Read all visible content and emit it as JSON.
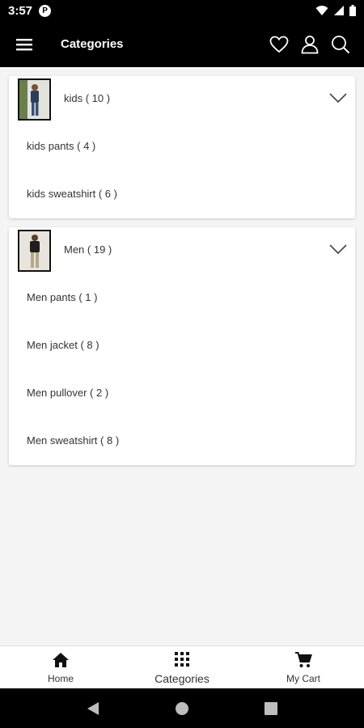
{
  "status_bar": {
    "time": "3:57",
    "app_icon_letter": "P",
    "icons": [
      "wifi-icon",
      "signal-icon",
      "battery-icon"
    ]
  },
  "app_bar": {
    "title": "Categories",
    "icons": [
      "menu-icon",
      "heart-icon",
      "user-icon",
      "search-icon"
    ]
  },
  "categories": [
    {
      "label": "kids ( 10 )",
      "expanded": true,
      "subcategories": [
        {
          "label": "kids pants ( 4 )"
        },
        {
          "label": "kids sweatshirt ( 6 )"
        }
      ]
    },
    {
      "label": "Men ( 19 )",
      "expanded": true,
      "subcategories": [
        {
          "label": "Men pants ( 1 )"
        },
        {
          "label": "Men jacket ( 8 )"
        },
        {
          "label": "Men pullover ( 2 )"
        },
        {
          "label": "Men sweatshirt ( 8 )"
        }
      ]
    }
  ],
  "bottom_nav": {
    "items": [
      {
        "label": "Home",
        "icon": "home-icon"
      },
      {
        "label": "Categories",
        "icon": "grid-icon",
        "active": true
      },
      {
        "label": "My Cart",
        "icon": "cart-icon"
      }
    ]
  },
  "system_nav": {
    "icons": [
      "back-icon",
      "home-circle-icon",
      "recents-icon"
    ]
  },
  "colors": {
    "app_bar": "#000000",
    "background": "#f4f4f4",
    "card": "#ffffff",
    "text": "#333333"
  }
}
